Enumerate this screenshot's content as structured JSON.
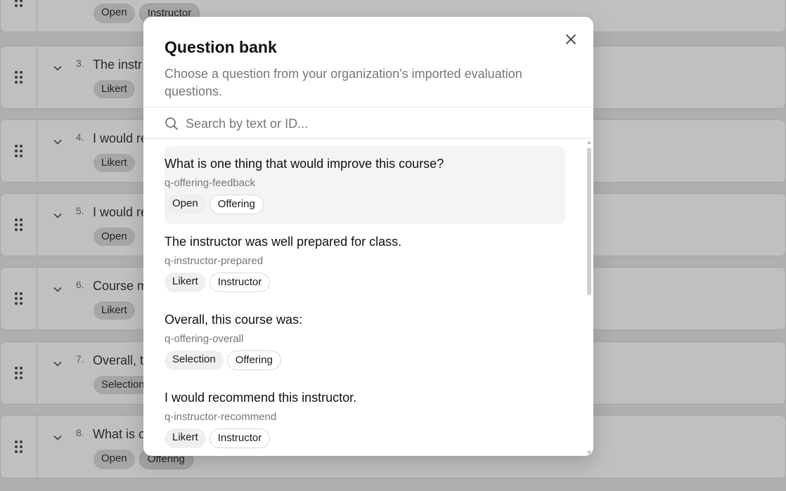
{
  "background": {
    "rows": [
      {
        "num": "",
        "text": "",
        "pills": [
          "Open",
          "Instructor"
        ]
      },
      {
        "num": "3.",
        "text": "The instr",
        "pills": [
          "Likert"
        ]
      },
      {
        "num": "4.",
        "text": "I would re",
        "pills": [
          "Likert"
        ]
      },
      {
        "num": "5.",
        "text": "I would re",
        "pills": [
          "Open"
        ]
      },
      {
        "num": "6.",
        "text": "Course m",
        "pills": [
          "Likert"
        ]
      },
      {
        "num": "7.",
        "text": "Overall, t",
        "pills": [
          "Selection"
        ]
      },
      {
        "num": "8.",
        "text": "What is o",
        "pills": [
          "Open",
          "Offering"
        ]
      }
    ]
  },
  "modal": {
    "title": "Question bank",
    "description": "Choose a question from your organization's imported evaluation questions.",
    "search": {
      "placeholder": "Search by text or ID...",
      "value": ""
    },
    "items": [
      {
        "text": "What is one thing that would improve this course?",
        "id": "q-offering-feedback",
        "type": "Open",
        "scope": "Offering"
      },
      {
        "text": "The instructor was well prepared for class.",
        "id": "q-instructor-prepared",
        "type": "Likert",
        "scope": "Instructor"
      },
      {
        "text": "Overall, this course was:",
        "id": "q-offering-overall",
        "type": "Selection",
        "scope": "Offering"
      },
      {
        "text": "I would recommend this instructor.",
        "id": "q-instructor-recommend",
        "type": "Likert",
        "scope": "Instructor"
      }
    ]
  },
  "icons": {
    "close": "close-icon",
    "search": "search-icon",
    "drag": "drag-handle-icon",
    "chevron": "chevron-down-icon"
  }
}
